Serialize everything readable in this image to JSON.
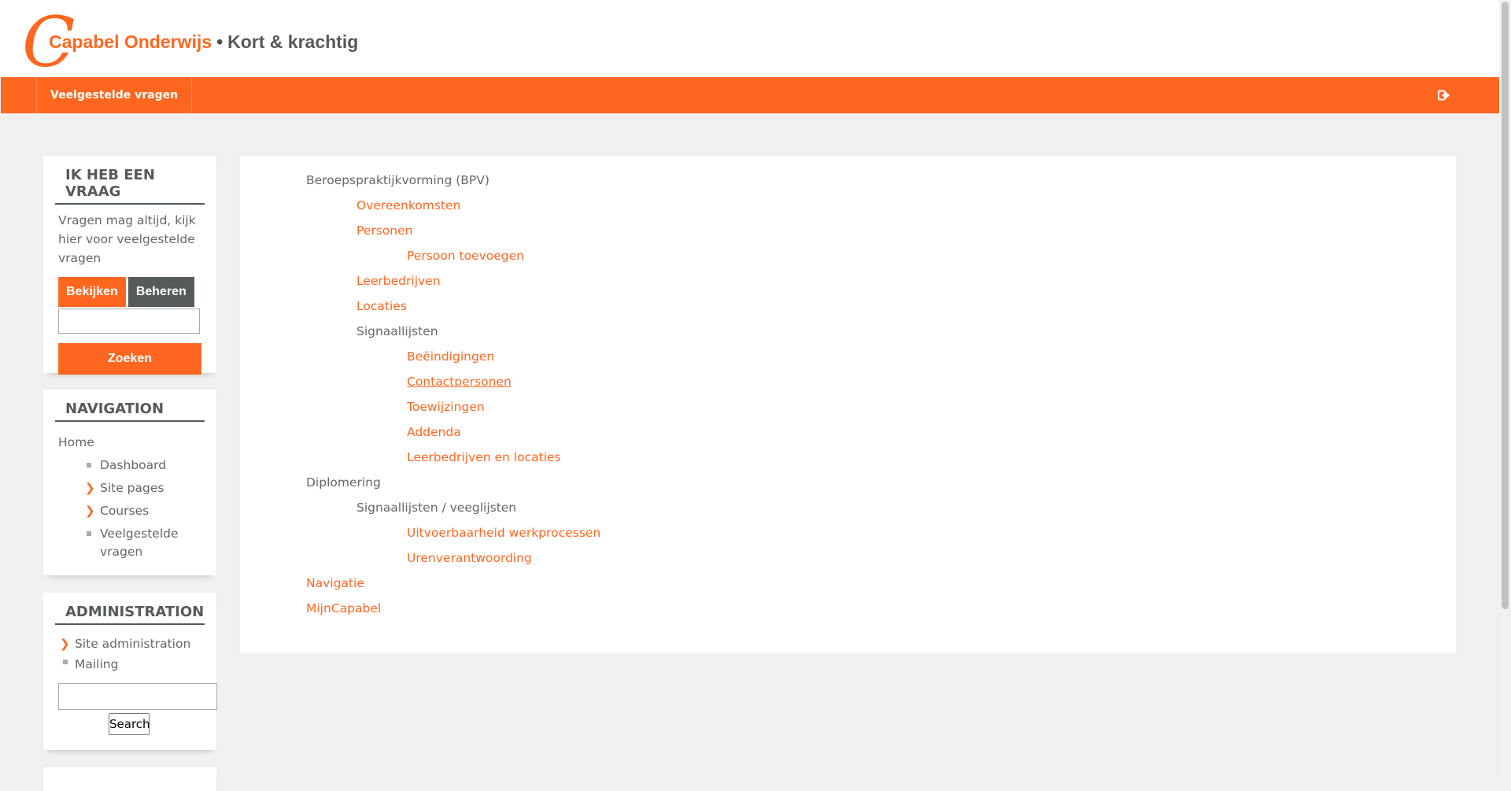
{
  "header": {
    "logo_letter": "C",
    "brand": "Capabel Onderwijs",
    "separator": "•",
    "slogan": "Kort & krachtig"
  },
  "navbar": {
    "items": [
      {
        "label": "Veelgestelde vragen"
      }
    ],
    "logout_icon": "logout-icon"
  },
  "faq_block": {
    "title": "IK HEB EEN VRAAG",
    "text": "Vragen mag altijd, kijk hier voor veelgestelde vragen",
    "tab_view": "Bekijken",
    "tab_manage": "Beheren",
    "search_value": "",
    "search_button": "Zoeken"
  },
  "navigation_block": {
    "title": "NAVIGATION",
    "home": "Home",
    "items": [
      {
        "label": "Dashboard",
        "icon": "square-bullet"
      },
      {
        "label": "Site pages",
        "icon": "chevron-right"
      },
      {
        "label": "Courses",
        "icon": "chevron-right"
      },
      {
        "label": "Veelgestelde vragen",
        "icon": "square-bullet"
      }
    ]
  },
  "administration_block": {
    "title": "ADMINISTRATION",
    "items": [
      {
        "label": "Site administration",
        "icon": "chevron-right"
      },
      {
        "label": "Mailing",
        "icon": "square-bullet"
      }
    ],
    "search_value": "",
    "search_button": "Search"
  },
  "main": {
    "tree": [
      {
        "label": "Beroepspraktijkvorming (BPV)",
        "level": 0,
        "link": false
      },
      {
        "label": "Overeenkomsten",
        "level": 1,
        "link": true
      },
      {
        "label": "Personen",
        "level": 1,
        "link": true
      },
      {
        "label": "Persoon toevoegen",
        "level": 2,
        "link": true
      },
      {
        "label": "Leerbedrijven",
        "level": 1,
        "link": true
      },
      {
        "label": "Locaties",
        "level": 1,
        "link": true
      },
      {
        "label": "Signaallijsten",
        "level": 1,
        "link": false
      },
      {
        "label": "Beëindigingen",
        "level": 2,
        "link": true
      },
      {
        "label": "Contactpersonen",
        "level": 2,
        "link": true,
        "hovered": true
      },
      {
        "label": "Toewijzingen",
        "level": 2,
        "link": true
      },
      {
        "label": "Addenda",
        "level": 2,
        "link": true
      },
      {
        "label": "Leerbedrijven en locaties",
        "level": 2,
        "link": true
      },
      {
        "label": "Diplomering",
        "level": 0,
        "link": false
      },
      {
        "label": "Signaallijsten / veeglijsten",
        "level": 1,
        "link": false
      },
      {
        "label": "Uitvoerbaarheid werkprocessen",
        "level": 2,
        "link": true
      },
      {
        "label": "Urenverantwoording",
        "level": 2,
        "link": true
      },
      {
        "label": "Navigatie",
        "level": 0,
        "link": true
      },
      {
        "label": "MijnCapabel",
        "level": 0,
        "link": true
      }
    ]
  },
  "colors": {
    "accent": "#ff6720",
    "dark": "#555a5a",
    "background": "#f1f0ee"
  }
}
